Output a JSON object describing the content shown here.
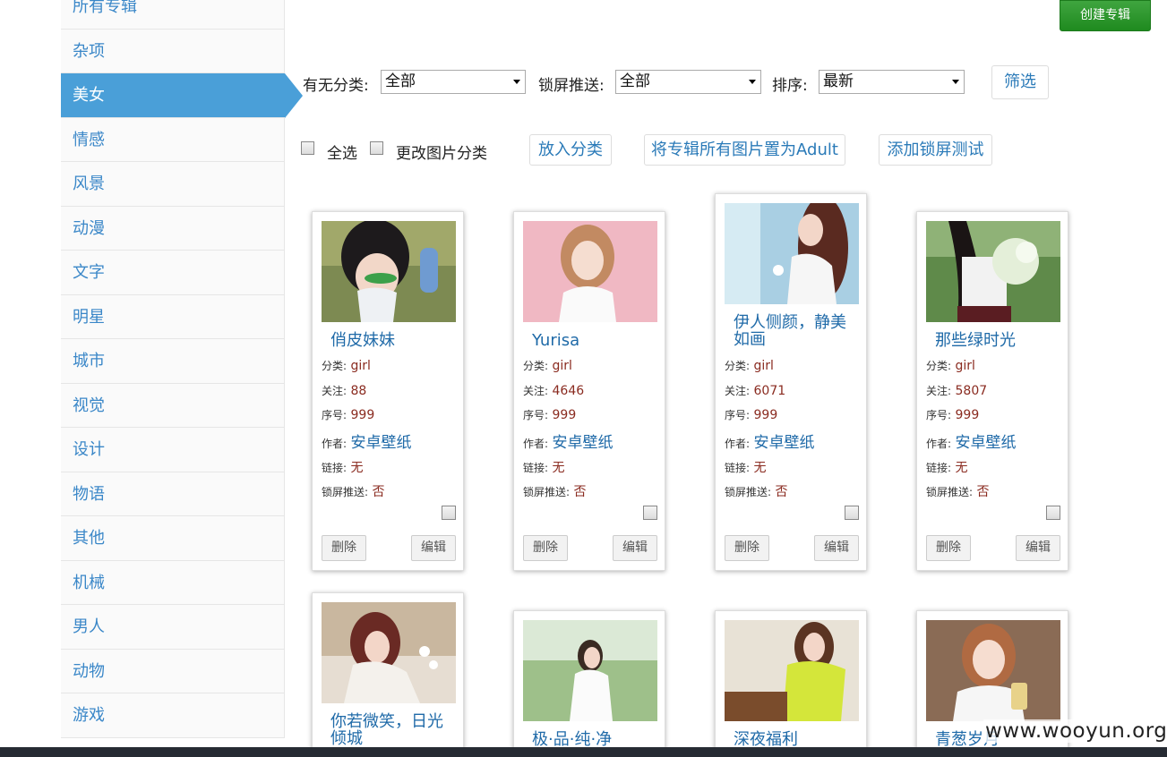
{
  "sidebar": {
    "items": [
      {
        "label": "所有专辑",
        "active": false
      },
      {
        "label": "杂项",
        "active": false
      },
      {
        "label": "美女",
        "active": true
      },
      {
        "label": "情感",
        "active": false
      },
      {
        "label": "风景",
        "active": false
      },
      {
        "label": "动漫",
        "active": false
      },
      {
        "label": "文字",
        "active": false
      },
      {
        "label": "明星",
        "active": false
      },
      {
        "label": "城市",
        "active": false
      },
      {
        "label": "视觉",
        "active": false
      },
      {
        "label": "设计",
        "active": false
      },
      {
        "label": "物语",
        "active": false
      },
      {
        "label": "其他",
        "active": false
      },
      {
        "label": "机械",
        "active": false
      },
      {
        "label": "男人",
        "active": false
      },
      {
        "label": "动物",
        "active": false
      },
      {
        "label": "游戏",
        "active": false
      }
    ]
  },
  "toolbar": {
    "create_label": "创建专辑"
  },
  "filters": {
    "category_label": "有无分类:",
    "category_value": "全部",
    "lock_label": "锁屏推送:",
    "lock_value": "全部",
    "sort_label": "排序:",
    "sort_value": "最新",
    "filter_button": "筛选"
  },
  "actions": {
    "select_all": "全选",
    "change_category": "更改图片分类",
    "put_in_category": "放入分类",
    "set_adult": "将专辑所有图片置为Adult",
    "add_lock_test": "添加锁屏测试"
  },
  "labels": {
    "category": "分类:",
    "follow": "关注:",
    "order": "序号:",
    "author": "作者:",
    "link": "链接:",
    "lock": "锁屏推送:",
    "delete": "删除",
    "edit": "编辑"
  },
  "cards": [
    {
      "title": "俏皮妹妹",
      "category": "girl",
      "follow": "88",
      "order": "999",
      "author": "安卓壁纸",
      "link": "无",
      "lock": "否"
    },
    {
      "title": "Yurisa",
      "category": "girl",
      "follow": "4646",
      "order": "999",
      "author": "安卓壁纸",
      "link": "无",
      "lock": "否"
    },
    {
      "title": "伊人侧颜，静美如画",
      "category": "girl",
      "follow": "6071",
      "order": "999",
      "author": "安卓壁纸",
      "link": "无",
      "lock": "否"
    },
    {
      "title": "那些绿时光",
      "category": "girl",
      "follow": "5807",
      "order": "999",
      "author": "安卓壁纸",
      "link": "无",
      "lock": "否"
    },
    {
      "title": "你若微笑，日光倾城"
    },
    {
      "title": "极·品·纯·净"
    },
    {
      "title": "深夜福利"
    },
    {
      "title": "青葱岁月"
    }
  ],
  "watermark": "www.wooyun.org",
  "colors": {
    "accent": "#4a9fd8",
    "link": "#1f6aa8",
    "create_button": "#2a962a"
  }
}
